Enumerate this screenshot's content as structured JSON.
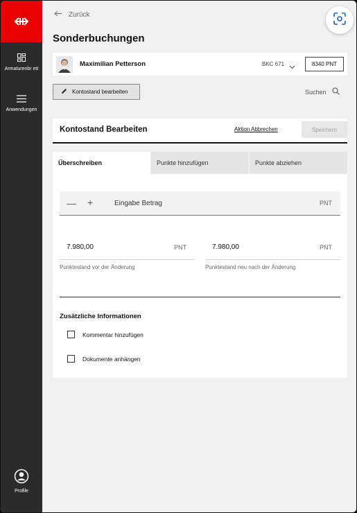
{
  "sidebar": {
    "logo_icon": "sbb-logo-icon",
    "brand_color": "#eb0000",
    "items": [
      {
        "label": "Armaturenbr ett",
        "icon": "dashboard-icon"
      },
      {
        "label": "Anwendungen",
        "icon": "menu-icon"
      }
    ],
    "profile": {
      "label": "Profile",
      "icon": "user-circle-icon"
    }
  },
  "header": {
    "back_label": "Zurück",
    "title": "Sonderbuchungen",
    "scan_icon": "scan-icon"
  },
  "user": {
    "name": "Maximilian Petterson",
    "account": "BKC 671",
    "points": "8340 PNT"
  },
  "toolbar": {
    "edit_label": "Kontostand bearbeiten",
    "search_label": "Suchen"
  },
  "panel": {
    "title": "Kontostand Bearbeiten",
    "abort_label": "Aktion Abbrechen",
    "save_label": "Speichern"
  },
  "tabs": [
    {
      "label": "Überschreiben",
      "active": true
    },
    {
      "label": "Punkte hinzufügen",
      "active": false
    },
    {
      "label": "Punkte abziehen",
      "active": false
    }
  ],
  "form": {
    "amount_placeholder": "Eingabe Betrag",
    "amount_unit": "PNT",
    "before": {
      "value": "7.980,00",
      "unit": "PNT",
      "caption": "Punktestand vor der Änderung"
    },
    "after": {
      "value": "7.980,00",
      "unit": "PNT",
      "caption": "Punktestand neu nach der Änderung"
    },
    "extra_title": "Zusätzliche Informationen",
    "options": [
      {
        "label": "Kommentar hinzufügen",
        "checked": false
      },
      {
        "label": "Dokumente anhängen",
        "checked": false
      }
    ]
  }
}
